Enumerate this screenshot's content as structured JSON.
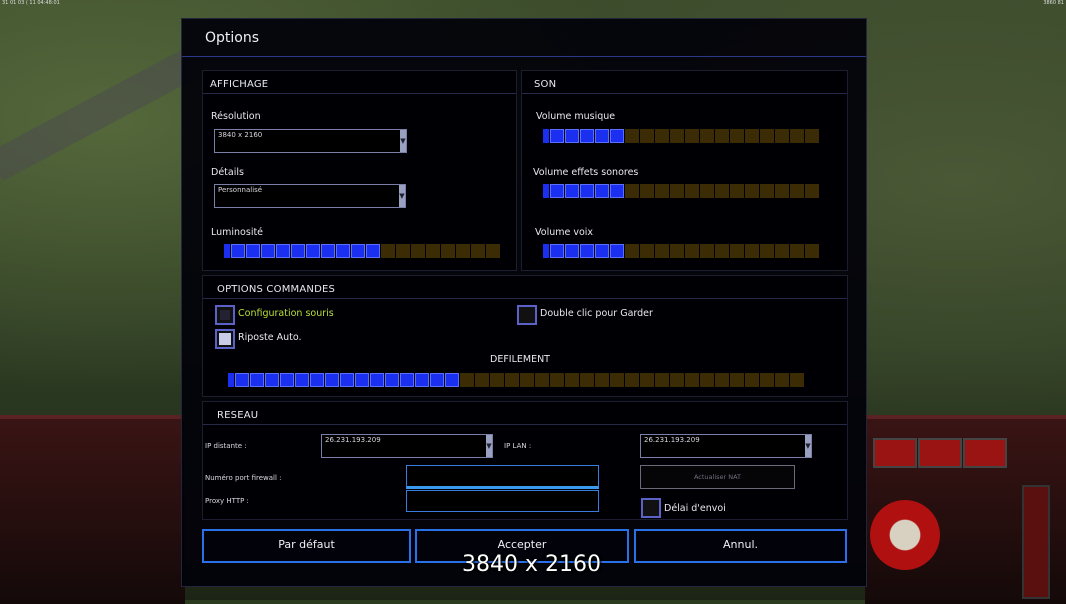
{
  "status": {
    "left": "31 01 03 ( 11 04:48:01",
    "right": "3860 81"
  },
  "dialog": {
    "title": "Options"
  },
  "affichage": {
    "header": "AFFICHAGE",
    "resolution": {
      "label": "Résolution",
      "value": "3840 x 2160"
    },
    "details": {
      "label": "Détails",
      "value": "Personnalisé"
    },
    "luminosite": {
      "label": "Luminosité",
      "level": 0.55
    }
  },
  "son": {
    "header": "SON",
    "musique": {
      "label": "Volume musique",
      "level": 0.27
    },
    "effets": {
      "label": "Volume effets sonores",
      "level": 0.27
    },
    "voix": {
      "label": "Volume voix",
      "level": 0.27
    }
  },
  "commandes": {
    "header": "OPTIONS COMMANDES",
    "config_souris": {
      "label": "Configuration souris",
      "checked": false
    },
    "riposte": {
      "label": "Riposte Auto.",
      "checked": true
    },
    "double_clic": {
      "label": "Double clic pour Garder",
      "checked": false
    },
    "defilement": {
      "label": "DEFILEMENT",
      "level": 0.39
    }
  },
  "reseau": {
    "header": "RESEAU",
    "ip_distante": {
      "label": "IP distante :",
      "value": "26.231.193.209"
    },
    "ip_lan": {
      "label": "IP LAN :",
      "value": "26.231.193.209"
    },
    "port_firewall": {
      "label": "Numéro port firewall :",
      "value": ""
    },
    "proxy": {
      "label": "Proxy HTTP :",
      "value": ""
    },
    "actualiser_nat": "Actualiser NAT",
    "delai": {
      "label": "Délai d'envoi",
      "checked": false
    }
  },
  "buttons": {
    "default": "Par défaut",
    "accept": "Accepter",
    "cancel": "Annul."
  },
  "tooltip": "3840 x 2160",
  "colors": {
    "accent": "#2a70e8",
    "slider_on": "#1a2ff0",
    "slider_off": "#3b2c06",
    "label_highlight": "#b8e03a"
  }
}
